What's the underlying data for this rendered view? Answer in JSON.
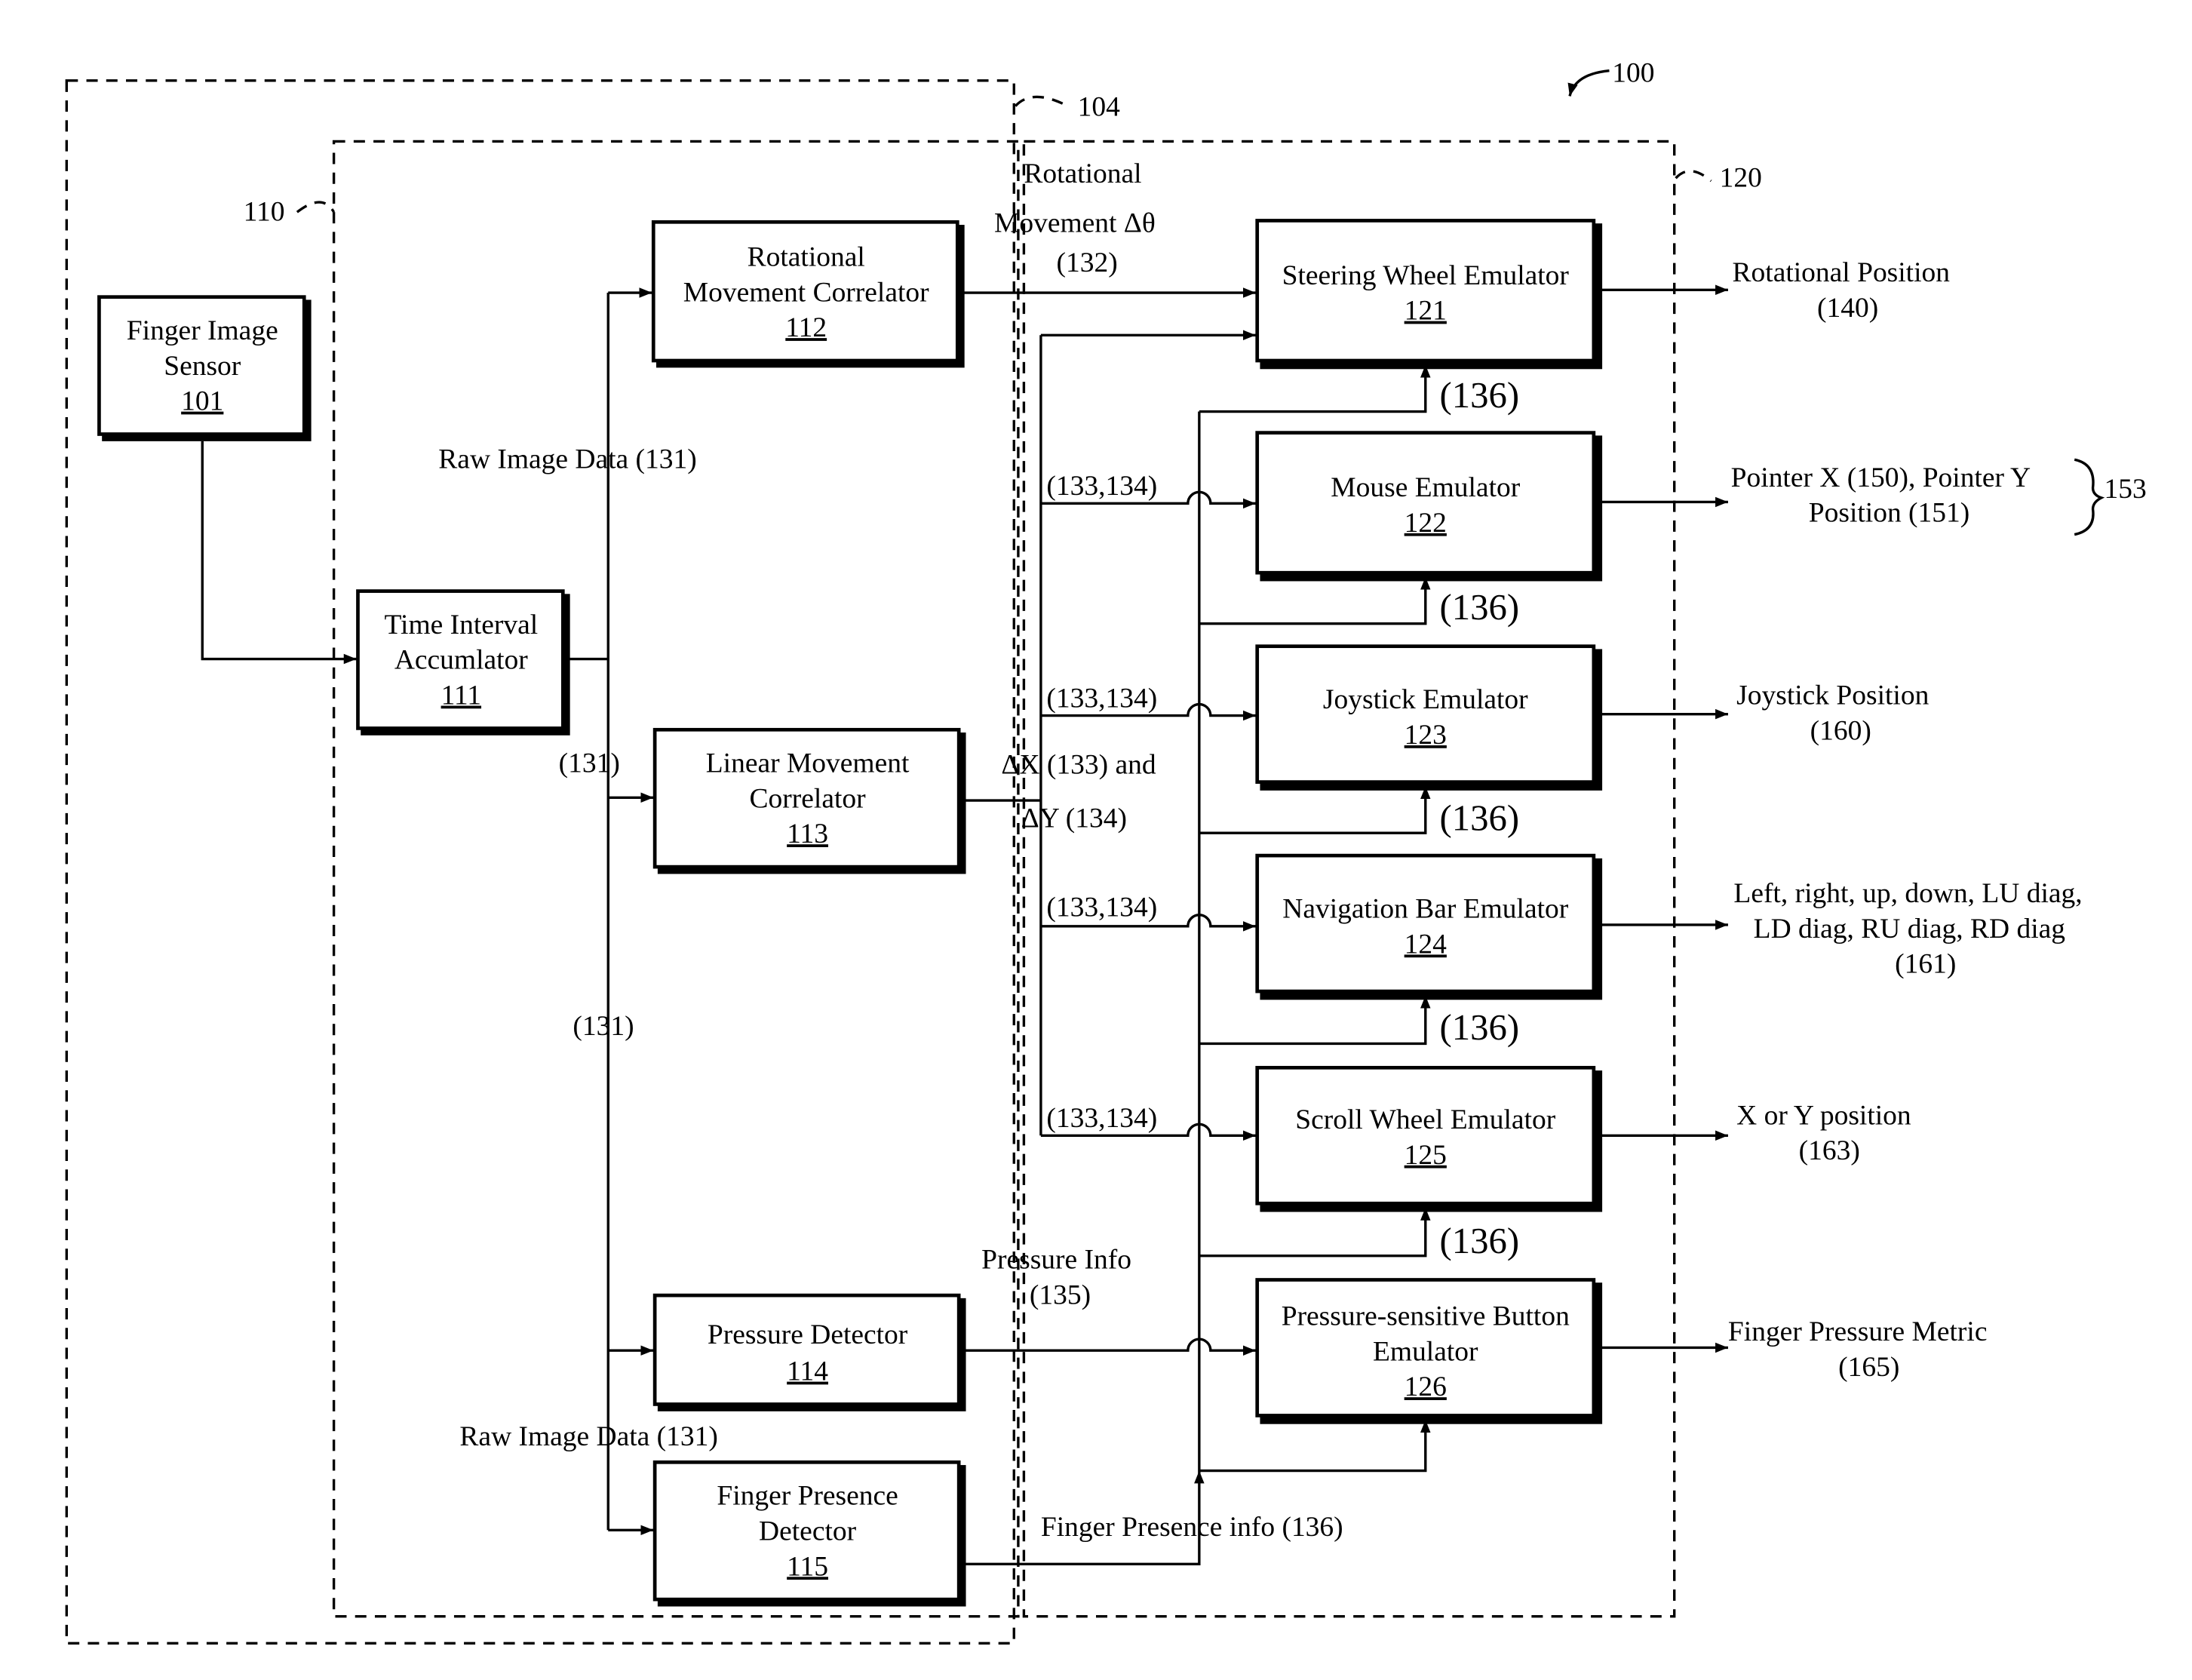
{
  "figure": {
    "ref_system": "100",
    "ref_outer": "104",
    "ref_sensor_group": "110",
    "ref_emulator_group": "120"
  },
  "blocks": {
    "sensor": {
      "line1": "Finger Image",
      "line2": "Sensor",
      "num": "101"
    },
    "accumulator": {
      "line1": "Time Interval",
      "line2": "Accumlator",
      "num": "111"
    },
    "rot_corr": {
      "line1": "Rotational",
      "line2": "Movement Correlator",
      "num": "112"
    },
    "lin_corr": {
      "line1": "Linear Movement",
      "line2": "Correlator",
      "num": "113"
    },
    "pressure": {
      "line1": "Pressure Detector",
      "num": "114"
    },
    "presence": {
      "line1": "Finger Presence",
      "line2": "Detector",
      "num": "115"
    },
    "steering": {
      "line1": "Steering Wheel Emulator",
      "num": "121"
    },
    "mouse": {
      "line1": "Mouse Emulator",
      "num": "122"
    },
    "joystick": {
      "line1": "Joystick Emulator",
      "num": "123"
    },
    "navbar": {
      "line1": "Navigation Bar Emulator",
      "num": "124"
    },
    "scroll": {
      "line1": "Scroll Wheel Emulator",
      "num": "125"
    },
    "button": {
      "line1": "Pressure-sensitive Button",
      "line2": "Emulator",
      "num": "126"
    }
  },
  "signals": {
    "raw_top": "Raw Image Data (131)",
    "raw_mid": "(131)",
    "raw_low": "(131)",
    "raw_bottom": "Raw Image Data (131)",
    "rot_1": "Rotational",
    "rot_2": "Movement Δθ",
    "rot_3": "(132)",
    "lin_1": "ΔX (133) and",
    "lin_2": "ΔY (134)",
    "xy": "(133,134)",
    "presence_tag": "(136)",
    "pressure_1": "Pressure Info",
    "pressure_2": "(135)",
    "presence_info": "Finger Presence info (136)"
  },
  "outputs": {
    "rot_1": "Rotational Position",
    "rot_2": "(140)",
    "ptr_1": "Pointer X (150), Pointer Y",
    "ptr_2": "Position (151)",
    "ptr_group": "153",
    "joy_1": "Joystick Position",
    "joy_2": "(160)",
    "nav_1": "Left, right, up, down, LU diag,",
    "nav_2": "LD diag, RU diag, RD diag",
    "nav_3": "(161)",
    "xy_1": "X or Y position",
    "xy_2": "(163)",
    "fp_1": "Finger Pressure Metric",
    "fp_2": "(165)"
  }
}
